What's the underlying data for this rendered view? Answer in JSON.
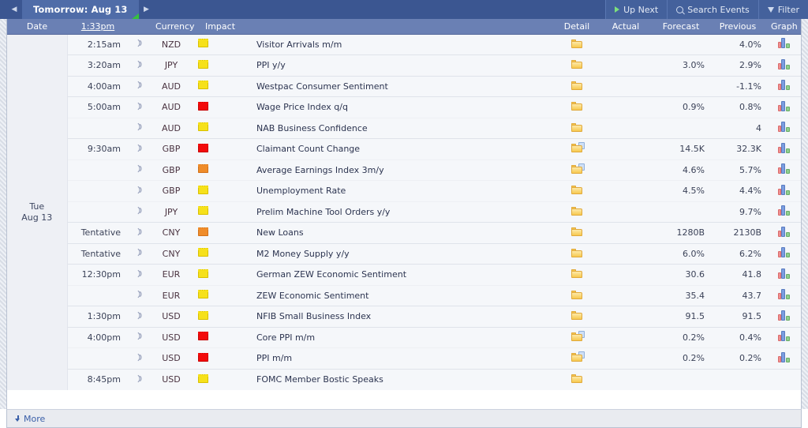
{
  "topbar": {
    "prev_label": "◀",
    "next_label": "▶",
    "day_tab": "Tomorrow: Aug 13",
    "up_next": "Up Next",
    "search_events": "Search Events",
    "filter": "Filter"
  },
  "columns": {
    "date": "Date",
    "time": "1:33pm",
    "bell": "",
    "currency": "Currency",
    "impact": "Impact",
    "event": "",
    "detail": "Detail",
    "actual": "Actual",
    "forecast": "Forecast",
    "previous": "Previous",
    "graph": "Graph"
  },
  "date_cell": {
    "weekday": "Tue",
    "daymonth": "Aug 13"
  },
  "rows": [
    {
      "time": "2:15am",
      "new_time": true,
      "currency": "NZD",
      "impact": "yellow",
      "event": "Visitor Arrivals m/m",
      "detail": "folder",
      "actual": "",
      "forecast": "",
      "previous": "4.0%",
      "graph": true
    },
    {
      "time": "3:20am",
      "new_time": true,
      "currency": "JPY",
      "impact": "yellow",
      "event": "PPI y/y",
      "detail": "folder",
      "actual": "",
      "forecast": "3.0%",
      "previous": "2.9%",
      "graph": true
    },
    {
      "time": "4:00am",
      "new_time": true,
      "currency": "AUD",
      "impact": "yellow",
      "event": "Westpac Consumer Sentiment",
      "detail": "folder",
      "actual": "",
      "forecast": "",
      "previous": "-1.1%",
      "graph": true
    },
    {
      "time": "5:00am",
      "new_time": true,
      "currency": "AUD",
      "impact": "red",
      "event": "Wage Price Index q/q",
      "detail": "folder",
      "actual": "",
      "forecast": "0.9%",
      "previous": "0.8%",
      "graph": true
    },
    {
      "time": "",
      "new_time": false,
      "currency": "AUD",
      "impact": "yellow",
      "event": "NAB Business Confidence",
      "detail": "folder",
      "actual": "",
      "forecast": "",
      "previous": "4",
      "graph": true
    },
    {
      "time": "9:30am",
      "new_time": true,
      "currency": "GBP",
      "impact": "red",
      "event": "Claimant Count Change",
      "detail": "folder-doc",
      "actual": "",
      "forecast": "14.5K",
      "previous": "32.3K",
      "graph": true
    },
    {
      "time": "",
      "new_time": false,
      "currency": "GBP",
      "impact": "orange",
      "event": "Average Earnings Index 3m/y",
      "detail": "folder-doc",
      "actual": "",
      "forecast": "4.6%",
      "previous": "5.7%",
      "graph": true
    },
    {
      "time": "",
      "new_time": false,
      "currency": "GBP",
      "impact": "yellow",
      "event": "Unemployment Rate",
      "detail": "folder",
      "actual": "",
      "forecast": "4.5%",
      "previous": "4.4%",
      "graph": true
    },
    {
      "time": "",
      "new_time": false,
      "currency": "JPY",
      "impact": "yellow",
      "event": "Prelim Machine Tool Orders y/y",
      "detail": "folder",
      "actual": "",
      "forecast": "",
      "previous": "9.7%",
      "graph": true
    },
    {
      "time": "Tentative",
      "new_time": true,
      "currency": "CNY",
      "impact": "orange",
      "event": "New Loans",
      "detail": "folder",
      "actual": "",
      "forecast": "1280B",
      "previous": "2130B",
      "graph": true
    },
    {
      "time": "Tentative",
      "new_time": true,
      "currency": "CNY",
      "impact": "yellow",
      "event": "M2 Money Supply y/y",
      "detail": "folder",
      "actual": "",
      "forecast": "6.0%",
      "previous": "6.2%",
      "graph": true
    },
    {
      "time": "12:30pm",
      "new_time": true,
      "currency": "EUR",
      "impact": "yellow",
      "event": "German ZEW Economic Sentiment",
      "detail": "folder",
      "actual": "",
      "forecast": "30.6",
      "previous": "41.8",
      "graph": true
    },
    {
      "time": "",
      "new_time": false,
      "currency": "EUR",
      "impact": "yellow",
      "event": "ZEW Economic Sentiment",
      "detail": "folder",
      "actual": "",
      "forecast": "35.4",
      "previous": "43.7",
      "graph": true
    },
    {
      "time": "1:30pm",
      "new_time": true,
      "currency": "USD",
      "impact": "yellow",
      "event": "NFIB Small Business Index",
      "detail": "folder",
      "actual": "",
      "forecast": "91.5",
      "previous": "91.5",
      "graph": true
    },
    {
      "time": "4:00pm",
      "new_time": true,
      "currency": "USD",
      "impact": "red",
      "event": "Core PPI m/m",
      "detail": "folder-doc",
      "actual": "",
      "forecast": "0.2%",
      "previous": "0.4%",
      "graph": true
    },
    {
      "time": "",
      "new_time": false,
      "currency": "USD",
      "impact": "red",
      "event": "PPI m/m",
      "detail": "folder-doc",
      "actual": "",
      "forecast": "0.2%",
      "previous": "0.2%",
      "graph": true
    },
    {
      "time": "8:45pm",
      "new_time": true,
      "currency": "USD",
      "impact": "yellow",
      "event": "FOMC Member Bostic Speaks",
      "detail": "folder",
      "actual": "",
      "forecast": "",
      "previous": "",
      "graph": false
    }
  ],
  "footer": {
    "more": "More"
  },
  "colors": {
    "header_bar": "#3b5691",
    "tab_active": "#4f6ca8",
    "col_header": "#6a80b4",
    "impact_yellow": "#f6e11b",
    "impact_orange": "#ef8c2a",
    "impact_red": "#f30b0b",
    "link": "#3a5fa8"
  }
}
